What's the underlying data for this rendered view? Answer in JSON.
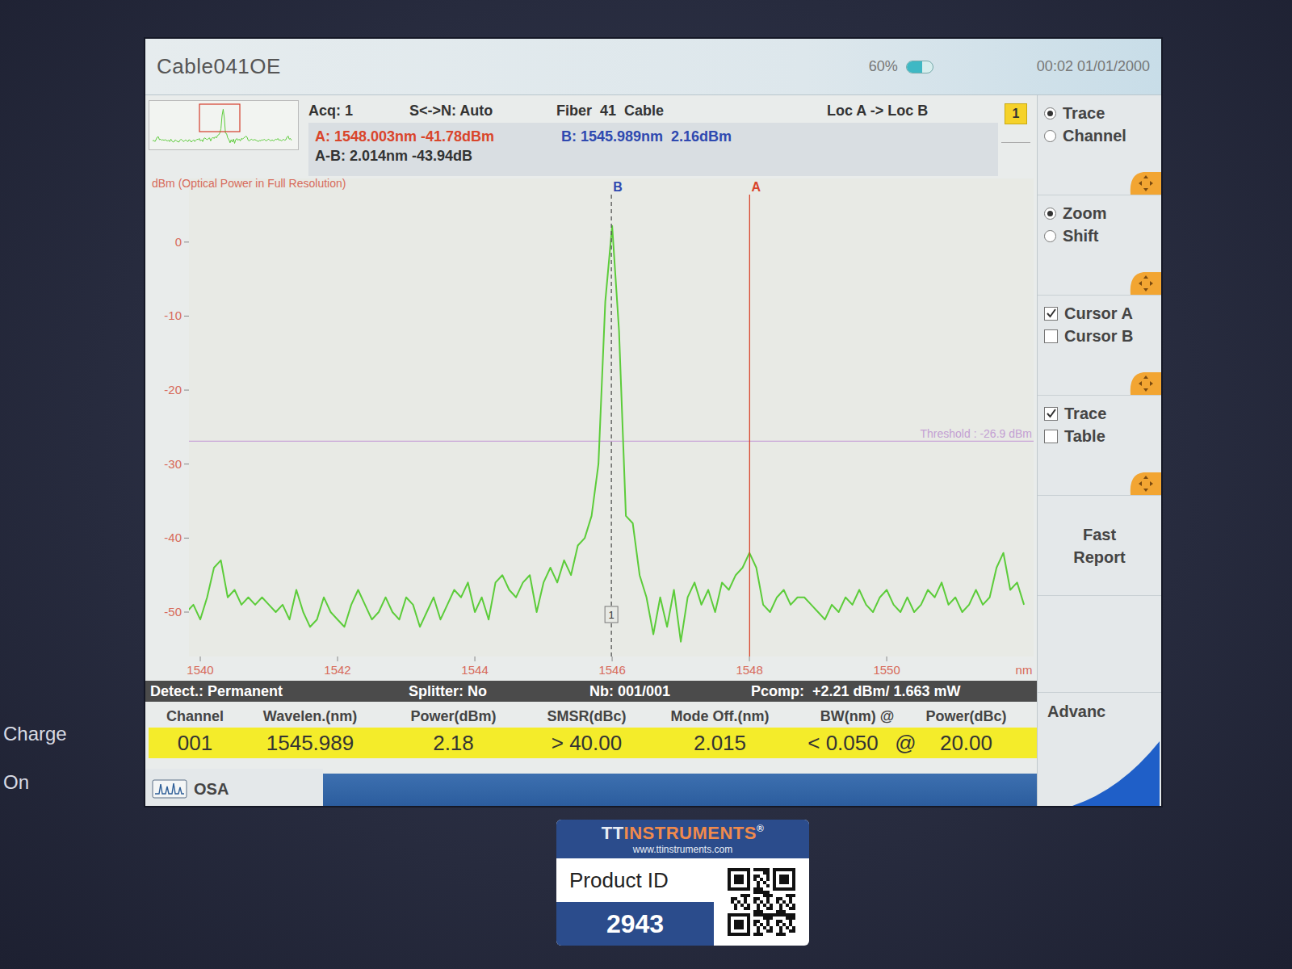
{
  "window": {
    "title": "Cable041OE"
  },
  "header": {
    "battery": "60%",
    "battery_level": 0.6,
    "clock": "00:02 01/01/2000"
  },
  "info": {
    "acq": "Acq: 1",
    "sn": "S<->N: Auto",
    "fiber": "Fiber  41  Cable",
    "direction": "Loc A -> Loc B",
    "badge": "1",
    "cursor_a": "A: 1548.003nm -41.78dBm",
    "cursor_b": "B: 1545.989nm  2.16dBm",
    "delta": "A-B: 2.014nm -43.94dB"
  },
  "chart": {
    "y_title": "dBm  (Optical Power in Full Resolution)",
    "y_ticks": [
      "0",
      "-10",
      "-20",
      "-30",
      "-40",
      "-50"
    ],
    "x_ticks": [
      "1540",
      "1542",
      "1544",
      "1546",
      "1548",
      "1550"
    ],
    "x_unit": "nm",
    "threshold": {
      "label": "Threshold : -26.9 dBm",
      "value": -26.9
    },
    "cursors": [
      {
        "label": "B",
        "wavelength": 1545.989,
        "color": "#2f49b0",
        "dashed": true,
        "marker": "1"
      },
      {
        "label": "A",
        "wavelength": 1548.003,
        "color": "#d9452b",
        "dashed": false,
        "marker": ""
      }
    ],
    "series": [
      {
        "name": "trace",
        "start": 1539.8,
        "step": 0.1,
        "color": "#5ccc3a",
        "values": [
          -50,
          -49,
          -51,
          -48,
          -44,
          -43,
          -48,
          -47,
          -49,
          -48,
          -49,
          -48,
          -49,
          -50,
          -49,
          -51,
          -47,
          -50,
          -52,
          -51,
          -48,
          -50,
          -51,
          -52,
          -49,
          -47,
          -49,
          -51,
          -50,
          -48,
          -50,
          -51,
          -48,
          -49,
          -52,
          -50,
          -48,
          -51,
          -49,
          -47,
          -48,
          -46,
          -50,
          -48,
          -51,
          -46,
          -45,
          -47,
          -48,
          -46,
          -45,
          -50,
          -46,
          -44,
          -46,
          -43,
          -45,
          -41,
          -40,
          -37,
          -30,
          -8,
          2.2,
          -12,
          -37,
          -38,
          -45,
          -48,
          -53,
          -48,
          -52,
          -47,
          -54,
          -48,
          -46,
          -49,
          -47,
          -50,
          -46,
          -47,
          -45,
          -44,
          -42,
          -44,
          -49,
          -50,
          -48,
          -47,
          -49,
          -48,
          -48,
          -49,
          -50,
          -51,
          -49,
          -50,
          -48,
          -49,
          -47,
          -49,
          -50,
          -48,
          -47,
          -49,
          -50,
          -48,
          -50,
          -49,
          -47,
          -48,
          -46,
          -49,
          -48,
          -50,
          -49,
          -47,
          -49,
          -48,
          -44,
          -42,
          -47,
          -46,
          -49
        ]
      }
    ]
  },
  "status_bar": [
    "Detect.: Permanent",
    "Splitter: No",
    "Nb: 001/001",
    "Pcomp:  +2.21 dBm/ 1.663 mW"
  ],
  "table": {
    "columns": [
      "Channel",
      "Wavelen.(nm)",
      "Power(dBm)",
      "SMSR(dBc)",
      "Mode Off.(nm)",
      "BW(nm) @",
      "Power(dBc)"
    ],
    "rows": [
      {
        "cells": [
          "001",
          "1545.989",
          "2.18",
          "> 40.00",
          "2.015",
          "< 0.050",
          "@",
          "20.00"
        ],
        "selected": true
      }
    ]
  },
  "bottom_tabs": [
    {
      "label": "OSA",
      "selected": true
    }
  ],
  "sidebar": {
    "groups": [
      {
        "kind": "radio",
        "items": [
          {
            "label": "Trace",
            "selected": true
          },
          {
            "label": "Channel",
            "selected": false
          }
        ]
      },
      {
        "kind": "radio",
        "items": [
          {
            "label": "Zoom",
            "selected": true
          },
          {
            "label": "Shift",
            "selected": false
          }
        ]
      },
      {
        "kind": "checkbox",
        "items": [
          {
            "label": "Cursor A",
            "checked": true
          },
          {
            "label": "Cursor B",
            "checked": false
          }
        ]
      },
      {
        "kind": "checkbox",
        "items": [
          {
            "label": "Trace",
            "checked": true
          },
          {
            "label": "Table",
            "checked": false
          }
        ]
      }
    ],
    "buttons": [
      "Fast Report",
      "Advanc"
    ]
  },
  "bezel": {
    "labels": [
      "Charge",
      "On"
    ]
  },
  "sticker": {
    "brand_a": "TT",
    "brand_b": "INSTRUMENTS",
    "mark": "®",
    "url": "www.ttinstruments.com",
    "label": "Product ID",
    "id": "2943"
  }
}
